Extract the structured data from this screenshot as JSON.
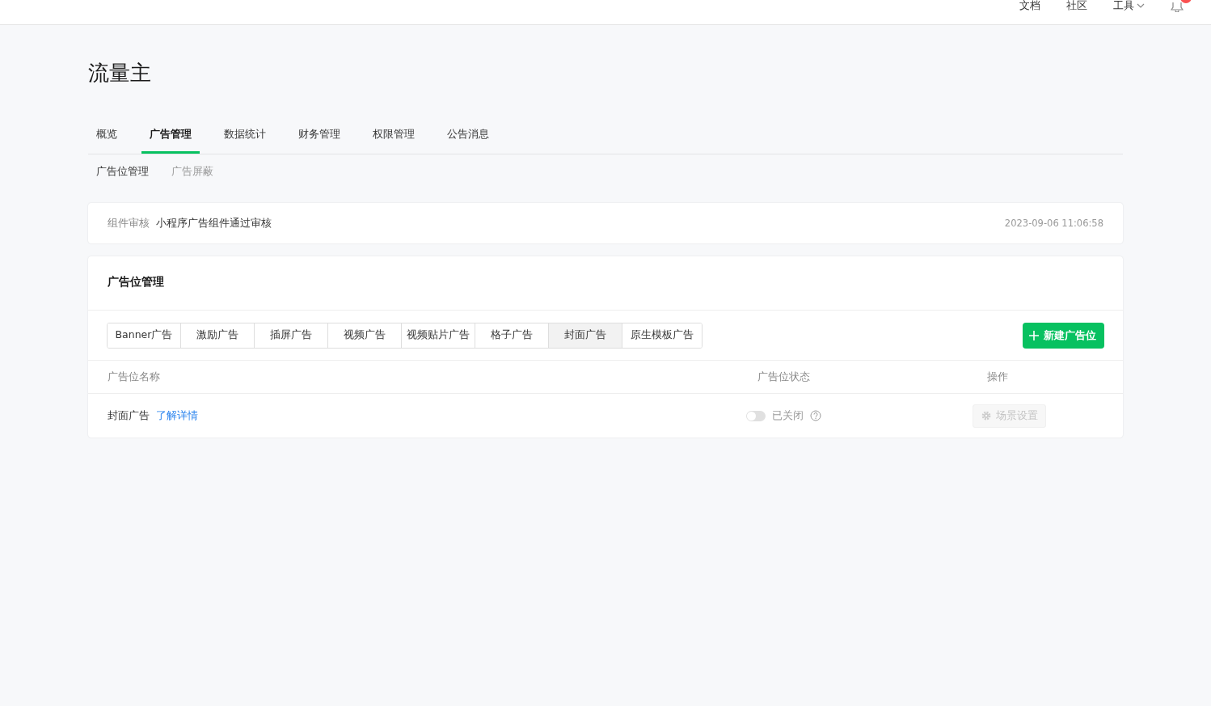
{
  "top_nav": {
    "links": [
      {
        "label": "文档",
        "dropdown": false
      },
      {
        "label": "社区",
        "dropdown": false
      },
      {
        "label": "工具",
        "dropdown": true
      }
    ],
    "notification_badge": true
  },
  "page_title": "流量主",
  "tabs": [
    {
      "label": "概览",
      "selected": false
    },
    {
      "label": "广告管理",
      "selected": true
    },
    {
      "label": "数据统计",
      "selected": false
    },
    {
      "label": "财务管理",
      "selected": false
    },
    {
      "label": "权限管理",
      "selected": false
    },
    {
      "label": "公告消息",
      "selected": false
    }
  ],
  "sub_tabs": [
    {
      "label": "广告位管理",
      "selected": true
    },
    {
      "label": "广告屏蔽",
      "selected": false
    }
  ],
  "notice": {
    "label": "组件审核",
    "message": "小程序广告组件通过审核",
    "time": "2023-09-06 11:06:58"
  },
  "panel": {
    "title": "广告位管理",
    "ad_types": [
      {
        "label": "Banner广告",
        "selected": false
      },
      {
        "label": "激励广告",
        "selected": false
      },
      {
        "label": "插屏广告",
        "selected": false
      },
      {
        "label": "视频广告",
        "selected": false
      },
      {
        "label": "视频贴片广告",
        "selected": false
      },
      {
        "label": "格子广告",
        "selected": false
      },
      {
        "label": "封面广告",
        "selected": true
      },
      {
        "label": "原生模板广告",
        "selected": false
      }
    ],
    "create_button": "新建广告位",
    "table": {
      "columns": [
        "广告位名称",
        "广告位状态",
        "操作"
      ],
      "rows": [
        {
          "name": "封面广告",
          "link": "了解详情",
          "on": false,
          "status": "已关闭",
          "action": "场景设置",
          "action_disabled": true
        }
      ]
    }
  }
}
